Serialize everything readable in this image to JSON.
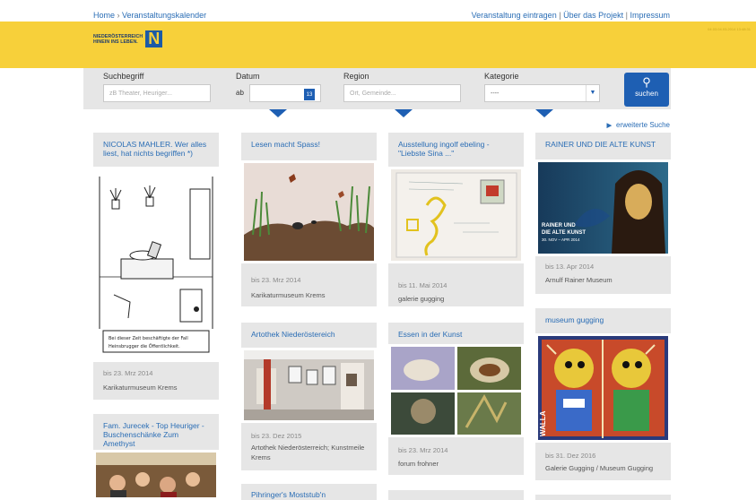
{
  "topnav": {
    "breadcrumb_home": "Home",
    "breadcrumb_sep": "›",
    "breadcrumb_current": "Veranstaltungskalender",
    "links": [
      "Veranstaltung eintragen",
      "Über das Projekt",
      "Impressum"
    ],
    "link_sep": "|"
  },
  "header": {
    "logo_line1": "NIEDERÖSTERREICH",
    "logo_line2": "HINEIN INS LEBEN.",
    "logo_letter": "N",
    "timestamp": "04.03.04.03.2014 13:48:31"
  },
  "search": {
    "suchbegriff_label": "Suchbegriff",
    "suchbegriff_placeholder": "zB Theater, Heuriger...",
    "datum_label": "Datum",
    "datum_prefix": "ab",
    "calendar_day": "13",
    "region_label": "Region",
    "region_placeholder": "Ort, Gemeinde...",
    "kategorie_label": "Kategorie",
    "kategorie_value": "----",
    "button_label": "suchen",
    "extended_label": "erweiterte Suche"
  },
  "cards": {
    "c1": {
      "title": "NICOLAS MAHLER. Wer alles liest, hat nichts begriffen *)",
      "caption": "Bei dieser Zeit beschäftigte der Fall Heinsbrugger die Öffentlichkeit.",
      "date": "bis 23. Mrz 2014",
      "location": "Karikaturmuseum Krems"
    },
    "c2": {
      "title": "Fam. Jurecek - Top Heuriger - Buschenschänke Zum Amethyst"
    },
    "c3": {
      "title": "Lesen macht Spass!",
      "date": "bis 23. Mrz 2014",
      "location": "Karikaturmuseum Krems"
    },
    "c4": {
      "title": "Artothek Niederöstereich",
      "date": "bis 23. Dez 2015",
      "location": "Artothek Niederösterreich; Kunstmeile Krems"
    },
    "c5": {
      "title": "Pihringer's Moststub'n"
    },
    "c6": {
      "title": "Ausstellung ingolf ebeling - \"Liebste Sina ...\"",
      "date": "bis 11. Mai 2014",
      "location": "galerie gugging"
    },
    "c7": {
      "title": "Essen in der Kunst",
      "date": "bis 23. Mrz 2014",
      "location": "forum frohner"
    },
    "c8": {
      "title": "RAINER UND DIE ALTE KUNST",
      "poster_line1": "RAINER UND",
      "poster_line2": "DIE ALTE KUNST",
      "poster_line3": "30. NOV – APR 2014",
      "date": "bis 13. Apr 2014",
      "location": "Arnulf Rainer Museum"
    },
    "c9": {
      "title": "museum gugging",
      "painting_text": "WALLA",
      "date": "bis 31. Dez 2016",
      "location": "Galerie Gugging / Museum Gugging"
    }
  },
  "colors": {
    "brand_yellow": "#f7d03a",
    "brand_blue": "#1e5fb3",
    "link_blue": "#2a6db5",
    "card_grey": "#e6e6e6"
  }
}
